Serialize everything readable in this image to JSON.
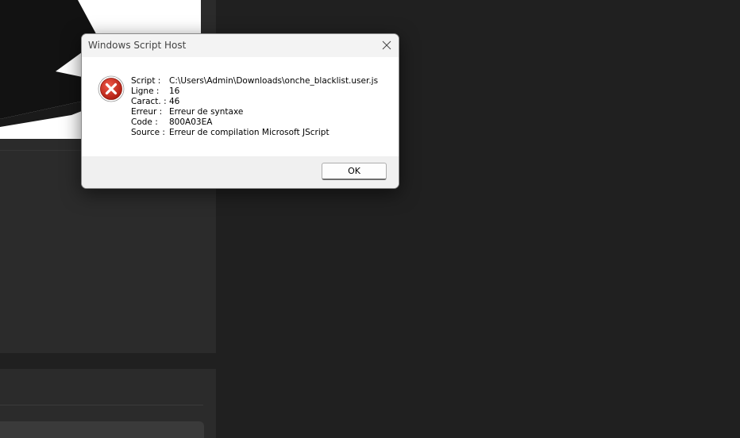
{
  "dialog": {
    "title": "Windows Script Host",
    "close_icon": "close-icon",
    "error_icon": "error-icon",
    "details": [
      {
        "label": "Script :",
        "value": "C:\\Users\\Admin\\Downloads\\onche_blacklist.user.js"
      },
      {
        "label": "Ligne :",
        "value": "16"
      },
      {
        "label": "Caract. :",
        "value": "46"
      },
      {
        "label": "Erreur :",
        "value": "Erreur de syntaxe"
      },
      {
        "label": "Code :",
        "value": "800A03EA"
      },
      {
        "label": "Source :",
        "value": "Erreur de compilation Microsoft JScript"
      }
    ],
    "ok_label": "OK"
  },
  "colors": {
    "desktop_bg": "#202020",
    "panel_bg": "#2b2b2b",
    "error_red": "#c42b1c"
  }
}
